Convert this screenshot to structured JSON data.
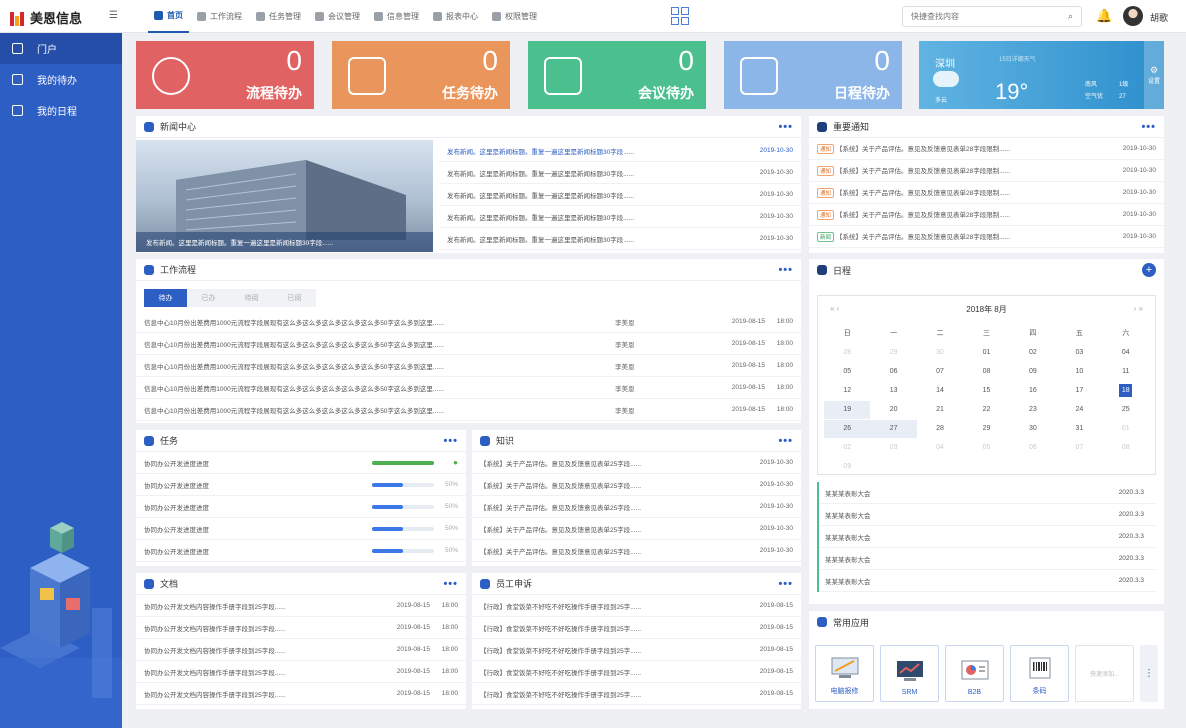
{
  "app": {
    "logo": "美恩信息",
    "menu_icon": "hamburger-icon"
  },
  "nav": [
    {
      "label": "首页",
      "active": true
    },
    {
      "label": "工作流程"
    },
    {
      "label": "任务管理"
    },
    {
      "label": "会议管理"
    },
    {
      "label": "信息管理"
    },
    {
      "label": "报表中心"
    },
    {
      "label": "权限管理"
    }
  ],
  "search": {
    "placeholder": "快捷查找内容"
  },
  "user": {
    "name": "胡歌"
  },
  "sidebar": [
    {
      "label": "门户",
      "active": true
    },
    {
      "label": "我的待办"
    },
    {
      "label": "我的日程"
    }
  ],
  "stats": [
    {
      "value": "0",
      "label": "流程待办",
      "color": "#e05f5f"
    },
    {
      "value": "0",
      "label": "任务待办",
      "color": "#e8965b"
    },
    {
      "value": "0",
      "label": "会议待办",
      "color": "#4cbf8f"
    },
    {
      "value": "0",
      "label": "日程待办",
      "color": "#8db6e8"
    }
  ],
  "weather": {
    "city": "深圳",
    "forecast": "15日详细天气",
    "temp": "19°",
    "cond": "多云",
    "wind_label": "南风",
    "wind_value": "1级",
    "air_label": "空气优",
    "air_value": "27",
    "settings": "设置"
  },
  "news": {
    "title": "新闻中心",
    "more": "•••",
    "caption": "发布新闻。这里是新闻标题。重复一遍这里是新闻标题30字段......",
    "items": [
      {
        "text": "发布新闻。这里是新闻标题。重复一遍这里是新闻标题30字段......",
        "date": "2019-10-30",
        "hl": true
      },
      {
        "text": "发布新闻。这里是新闻标题。重复一遍这里是新闻标题30字段......",
        "date": "2019-10-30",
        "hl": false
      },
      {
        "text": "发布新闻。这里是新闻标题。重复一遍这里是新闻标题30字段......",
        "date": "2019-10-30",
        "hl": false
      },
      {
        "text": "发布新闻。这里是新闻标题。重复一遍这里是新闻标题30字段......",
        "date": "2019-10-30",
        "hl": false
      },
      {
        "text": "发布新闻。这里是新闻标题。重复一遍这里是新闻标题30字段......",
        "date": "2019-10-30",
        "hl": false
      }
    ]
  },
  "notice": {
    "title": "重要通知",
    "more": "•••",
    "items": [
      {
        "tag": "通知",
        "text": "【系统】关于产品评估。意见及反馈意见表单28字段限制......",
        "date": "2019-10-30"
      },
      {
        "tag": "通知",
        "text": "【系统】关于产品评估。意见及反馈意见表单28字段限制......",
        "date": "2019-10-30"
      },
      {
        "tag": "通知",
        "text": "【系统】关于产品评估。意见及反馈意见表单28字段限制......",
        "date": "2019-10-30"
      },
      {
        "tag": "通知",
        "text": "【系统】关于产品评估。意见及反馈意见表单28字段限制......",
        "date": "2019-10-30"
      },
      {
        "tag": "新闻",
        "text": "【系统】关于产品评估。意见及反馈意见表单28字段限制......",
        "date": "2019-10-30"
      }
    ]
  },
  "workflow": {
    "title": "工作流程",
    "more": "•••",
    "tabs": [
      "待办",
      "已办",
      "待阅",
      "已阅"
    ],
    "items": [
      {
        "text": "信息中心10月份出差费用1000元流程字段展现有这么多这么多这么多这么多这么多50字这么多到这里......",
        "who": "李美恩",
        "date": "2019-08-15",
        "time": "18:00"
      },
      {
        "text": "信息中心10月份出差费用1000元流程字段展现有这么多这么多这么多这么多这么多50字这么多到这里......",
        "who": "李美恩",
        "date": "2019-08-15",
        "time": "18:00"
      },
      {
        "text": "信息中心10月份出差费用1000元流程字段展现有这么多这么多这么多这么多这么多50字这么多到这里......",
        "who": "李美恩",
        "date": "2019-08-15",
        "time": "18:00"
      },
      {
        "text": "信息中心10月份出差费用1000元流程字段展现有这么多这么多这么多这么多这么多50字这么多到这里......",
        "who": "李美恩",
        "date": "2019-08-15",
        "time": "18:00"
      },
      {
        "text": "信息中心10月份出差费用1000元流程字段展现有这么多这么多这么多这么多这么多50字这么多到这里......",
        "who": "李美恩",
        "date": "2019-08-15",
        "time": "18:00"
      }
    ]
  },
  "calendar": {
    "title": "日程",
    "month": "2018年 8月",
    "weekdays": [
      "日",
      "一",
      "二",
      "三",
      "四",
      "五",
      "六"
    ],
    "days": [
      "28",
      "29",
      "30",
      "01",
      "02",
      "03",
      "04",
      "05",
      "06",
      "07",
      "08",
      "09",
      "10",
      "11",
      "12",
      "13",
      "14",
      "15",
      "16",
      "17",
      "18",
      "19",
      "20",
      "21",
      "22",
      "23",
      "24",
      "25",
      "26",
      "27",
      "28",
      "29",
      "30",
      "31",
      "01",
      "02",
      "03",
      "04",
      "05",
      "06",
      "07",
      "08",
      "09"
    ],
    "events": [
      {
        "text": "某某某表彰大会",
        "date": "2020.3.3"
      },
      {
        "text": "某某某表彰大会",
        "date": "2020.3.3"
      },
      {
        "text": "某某某表彰大会",
        "date": "2020.3.3"
      },
      {
        "text": "某某某表彰大会",
        "date": "2020.3.3"
      },
      {
        "text": "某某某表彰大会",
        "date": "2020.3.3"
      }
    ]
  },
  "tasks": {
    "title": "任务",
    "more": "•••",
    "items": [
      {
        "text": "协同办公开发进度进度",
        "progress": 1.0,
        "pct": ""
      },
      {
        "text": "协同办公开发进度进度",
        "progress": 0.5,
        "pct": "50%"
      },
      {
        "text": "协同办公开发进度进度",
        "progress": 0.5,
        "pct": "50%"
      },
      {
        "text": "协同办公开发进度进度",
        "progress": 0.5,
        "pct": "50%"
      },
      {
        "text": "协同办公开发进度进度",
        "progress": 0.5,
        "pct": "50%"
      }
    ]
  },
  "knowledge": {
    "title": "知识",
    "more": "•••",
    "items": [
      {
        "text": "【系统】关于产品评估。意见及反馈意见表单25字段......",
        "date": "2019-10-30"
      },
      {
        "text": "【系统】关于产品评估。意见及反馈意见表单25字段......",
        "date": "2019-10-30"
      },
      {
        "text": "【系统】关于产品评估。意见及反馈意见表单25字段......",
        "date": "2019-10-30"
      },
      {
        "text": "【系统】关于产品评估。意见及反馈意见表单25字段......",
        "date": "2019-10-30"
      },
      {
        "text": "【系统】关于产品评估。意见及反馈意见表单25字段......",
        "date": "2019-10-30"
      }
    ]
  },
  "docs": {
    "title": "文档",
    "more": "•••",
    "items": [
      {
        "text": "协同办公开发文档内容操作手册字段到25字段......",
        "date": "2019-08-15",
        "time": "18:00"
      },
      {
        "text": "协同办公开发文档内容操作手册字段到25字段......",
        "date": "2019-08-15",
        "time": "18:00"
      },
      {
        "text": "协同办公开发文档内容操作手册字段到25字段......",
        "date": "2019-08-15",
        "time": "18:00"
      },
      {
        "text": "协同办公开发文档内容操作手册字段到25字段......",
        "date": "2019-08-15",
        "time": "18:00"
      },
      {
        "text": "协同办公开发文档内容操作手册字段到25字段......",
        "date": "2019-08-15",
        "time": "18:00"
      }
    ]
  },
  "appeal": {
    "title": "员工申诉",
    "more": "•••",
    "items": [
      {
        "text": "【行政】食堂饭菜不好吃不好吃操作手册字段到25字......",
        "date": "2019-08-15"
      },
      {
        "text": "【行政】食堂饭菜不好吃不好吃操作手册字段到25字......",
        "date": "2019-08-15"
      },
      {
        "text": "【行政】食堂饭菜不好吃不好吃操作手册字段到25字......",
        "date": "2019-08-15"
      },
      {
        "text": "【行政】食堂饭菜不好吃不好吃操作手册字段到25字......",
        "date": "2019-08-15"
      },
      {
        "text": "【行政】食堂饭菜不好吃不好吃操作手册字段到25字......",
        "date": "2019-08-15"
      }
    ]
  },
  "apps": {
    "title": "常用应用",
    "items": [
      "电脑报修",
      "SRM",
      "B2B",
      "条码"
    ],
    "add": "快速添加..."
  }
}
